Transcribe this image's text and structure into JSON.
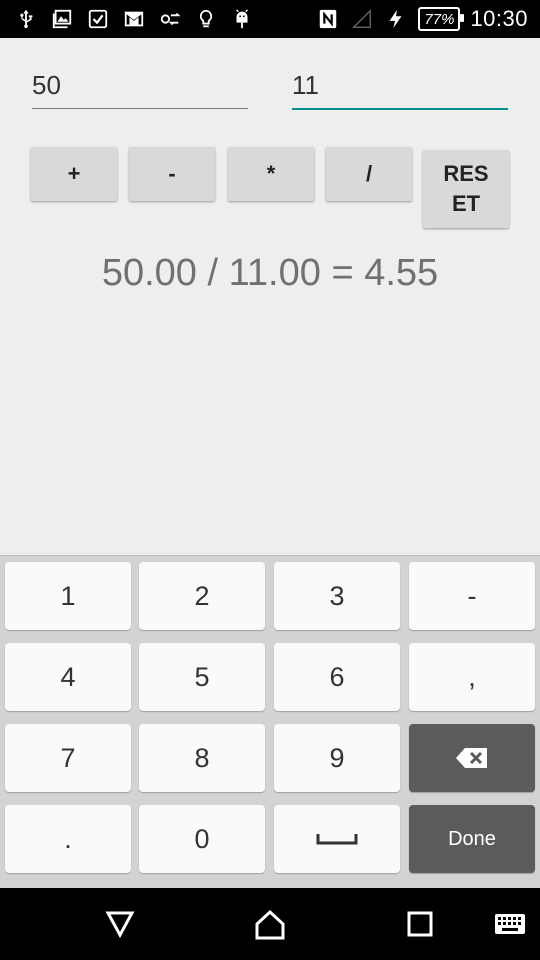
{
  "status_bar": {
    "icons": [
      "usb-icon",
      "gallery-notification-icon",
      "checkbox-notification-icon",
      "gmail-icon",
      "data-sync-icon",
      "lightbulb-icon",
      "android-icon",
      "nfc-icon",
      "signal-icon",
      "charging-icon"
    ],
    "battery": "77%",
    "time": "10:30"
  },
  "inputs": {
    "first_value": "50",
    "second_value": "11"
  },
  "operators": {
    "add": "+",
    "subtract": "-",
    "multiply": "*",
    "divide": "/",
    "reset_line1": "RES",
    "reset_line2": "ET"
  },
  "result": "50.00 / 11.00 = 4.55",
  "keyboard": {
    "row1": [
      "1",
      "2",
      "3",
      "-"
    ],
    "row2": [
      "4",
      "5",
      "6",
      ","
    ],
    "row3": [
      "7",
      "8",
      "9"
    ],
    "row4": [
      ".",
      "0"
    ],
    "done": "Done"
  },
  "nav_bar": {
    "icons": [
      "back-icon",
      "home-icon",
      "recents-icon",
      "keyboard-icon"
    ]
  }
}
